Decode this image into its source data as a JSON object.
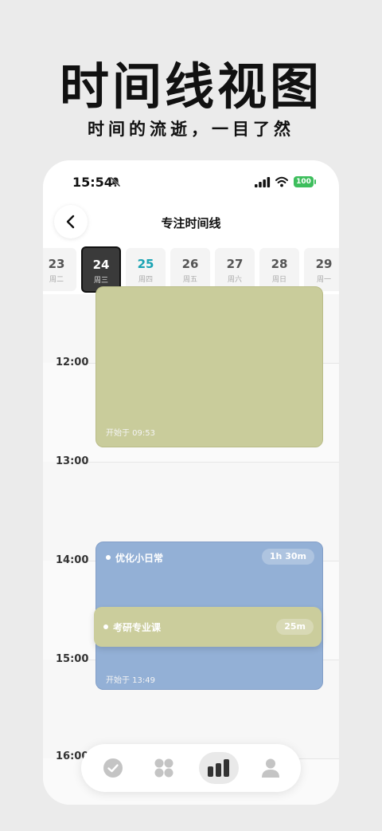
{
  "hero": {
    "title": "时间线视图",
    "subtitle": "时间的流逝，一目了然"
  },
  "status_bar": {
    "time": "15:54",
    "battery": "100",
    "icons": [
      "bell-muted-icon",
      "signal-icon",
      "wifi-icon",
      "battery-icon"
    ]
  },
  "nav": {
    "title": "专注时间线",
    "back_icon": "chevron-left-icon"
  },
  "dates": [
    {
      "day": "23",
      "weekday": "周二",
      "state": "normal"
    },
    {
      "day": "24",
      "weekday": "周三",
      "state": "selected"
    },
    {
      "day": "25",
      "weekday": "周四",
      "state": "today"
    },
    {
      "day": "26",
      "weekday": "周五",
      "state": "normal"
    },
    {
      "day": "27",
      "weekday": "周六",
      "state": "normal"
    },
    {
      "day": "28",
      "weekday": "周日",
      "state": "normal"
    },
    {
      "day": "29",
      "weekday": "周一",
      "state": "normal"
    }
  ],
  "timeline": {
    "hours": [
      "12:00",
      "13:00",
      "14:00",
      "15:00",
      "16:00"
    ],
    "events": [
      {
        "start_label": "开始于 09:53",
        "color": "#c9cc9b"
      },
      {
        "name": "优化小日常",
        "duration": "1h 30m",
        "start_label": "开始于 13:49",
        "color": "#93b0d6"
      },
      {
        "name": "考研专业课",
        "duration": "25m",
        "color": "#cbcd9c"
      }
    ]
  },
  "tabs": [
    {
      "icon": "check-circle-icon",
      "active": false
    },
    {
      "icon": "grid-icon",
      "active": false
    },
    {
      "icon": "bar-chart-icon",
      "active": true
    },
    {
      "icon": "user-icon",
      "active": false
    }
  ],
  "colors": {
    "accent_today": "#1aa3b3",
    "battery": "#3dbe5c",
    "event_green": "#c9cc9b",
    "event_blue": "#93b0d6"
  }
}
